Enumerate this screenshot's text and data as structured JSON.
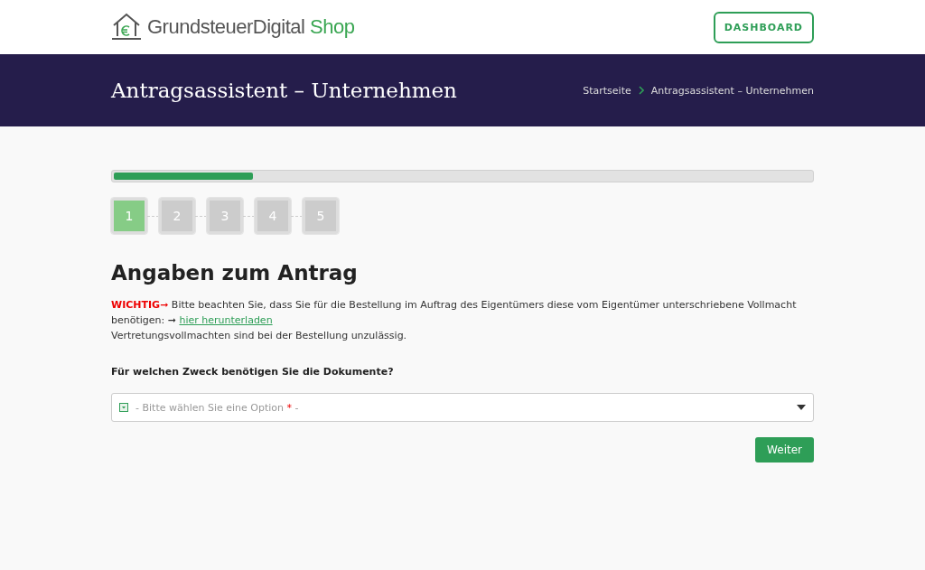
{
  "header": {
    "logo_text": "GrundsteuerDigital",
    "logo_accent": "Shop",
    "button": "DASHBOARD"
  },
  "banner": {
    "title": "Antragsassistent – Unternehmen",
    "breadcrumb": [
      "Startseite",
      "Antragsassistent – Unternehmen"
    ]
  },
  "progress": {
    "level": 0.2
  },
  "steps": [
    {
      "label": "1",
      "selected": true
    },
    {
      "label": "2",
      "selected": false
    },
    {
      "label": "3",
      "selected": false
    },
    {
      "label": "4",
      "selected": false
    },
    {
      "label": "5",
      "selected": false
    }
  ],
  "heading": "Angaben zum Antrag",
  "notice": {
    "label": "WICHTIG",
    "arrow": "➞",
    "text": "Bitte beachten Sie, dass Sie für die Bestellung im Auftrag des Eigentümers diese vom Eigentümer unterschriebene Vollmacht benötigen:",
    "link_arrow": "➞",
    "link": "hier herunterladen",
    "note": "Vertretungsvollmachten sind bei der Bestellung unzulässig."
  },
  "question": "Für welchen Zweck benötigen Sie die Dokumente?",
  "select": {
    "placeholder": "- Bitte wählen Sie eine Option",
    "required_mark": "*",
    "placeholder_end": "-"
  },
  "submit": "Weiter"
}
